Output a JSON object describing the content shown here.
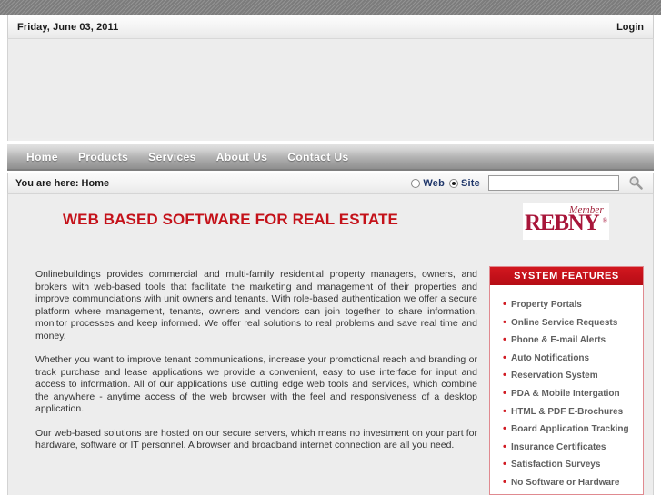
{
  "utility_bar": {
    "date": "Friday, June 03, 2011",
    "login_label": "Login"
  },
  "nav": {
    "items": [
      {
        "label": "Home"
      },
      {
        "label": "Products"
      },
      {
        "label": "Services"
      },
      {
        "label": "About Us"
      },
      {
        "label": "Contact Us"
      }
    ]
  },
  "breadcrumb": {
    "text": "You are here: Home"
  },
  "search": {
    "scope_web_label": "Web",
    "scope_site_label": "Site",
    "selected_scope": "Site",
    "input_value": "",
    "placeholder": "",
    "icon": "search-icon"
  },
  "main": {
    "headline": "WEB BASED SOFTWARE FOR REAL ESTATE",
    "logo": {
      "member_text": "Member",
      "brand_text": "REBNY",
      "trademark": "®"
    },
    "paragraphs": [
      "Onlinebuildings provides commercial and multi-family residential property managers, owners, and brokers with web-based tools that facilitate the marketing and management of their properties and improve communciations with unit owners and tenants. With role-based authentication we offer a secure platform where management, tenants, owners and vendors can join together to share information, monitor processes and keep informed.  We offer real solutions to real problems and save real time and money.",
      "Whether you want to improve tenant communications, increase your promotional reach and branding or track purchase and lease applications we provide a convenient, easy to use interface for input and access to information. All of our applications use cutting edge web tools and services, which combine the anywhere - anytime access of the web browser with the feel and responsiveness of a desktop application.",
      "Our web-based solutions are hosted on our secure servers, which means no investment on your part for hardware, software or IT personnel.  A browser and broadband internet connection are all you need."
    ]
  },
  "features_panel": {
    "title": "SYSTEM FEATURES",
    "items": [
      {
        "label": "Property Portals"
      },
      {
        "label": "Online Service Requests"
      },
      {
        "label": "Phone & E-mail Alerts"
      },
      {
        "label": "Auto Notifications"
      },
      {
        "label": "Reservation System"
      },
      {
        "label": "PDA & Mobile Intergation"
      },
      {
        "label": "HTML & PDF E-Brochures"
      },
      {
        "label": "Board Application Tracking"
      },
      {
        "label": "Insurance Certificates"
      },
      {
        "label": "Satisfaction Surveys"
      },
      {
        "label": "No Software or Hardware"
      }
    ]
  },
  "colors": {
    "brand_red": "#c4121a",
    "panel_header_red": "#c4111a",
    "panel_border": "#e08a90",
    "bullet_red": "#d11a22",
    "radio_label_blue": "#21386b",
    "page_bg": "#ededed",
    "topbar_gray": "#838383"
  }
}
